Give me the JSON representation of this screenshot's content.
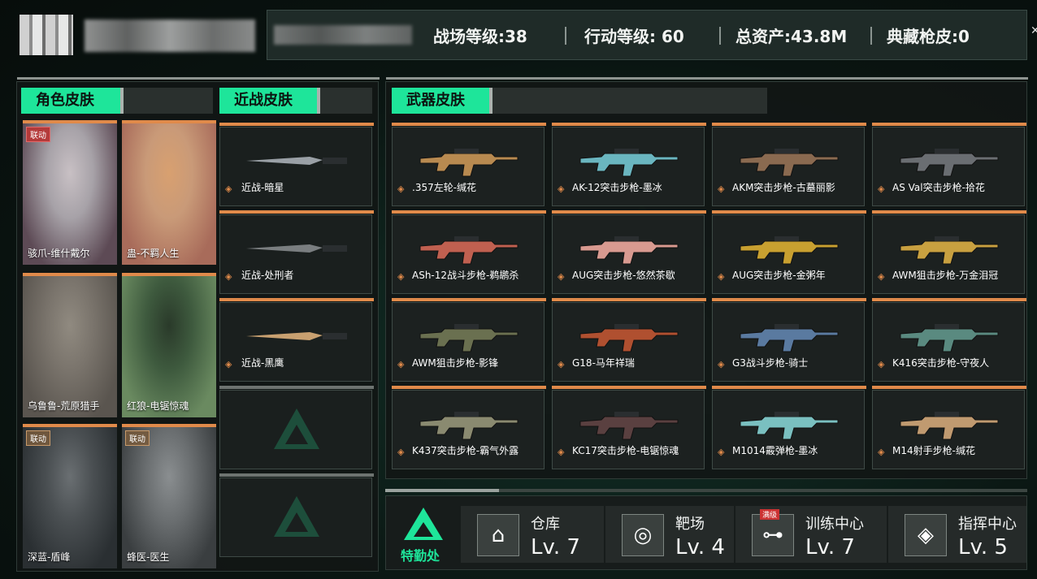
{
  "header": {
    "stats": [
      {
        "label": "战场等级:38"
      },
      {
        "label": "行动等级: 60"
      },
      {
        "label": "总资产:43.8M"
      },
      {
        "label": "典藏枪皮:0"
      }
    ]
  },
  "character_skins": {
    "tab": "角色皮肤",
    "items": [
      {
        "name": "骇爪-维什戴尔",
        "badge": "联动",
        "badge_style": "red",
        "art": [
          "#a7a2a8",
          "#5d4a55",
          "#c8c0c4"
        ]
      },
      {
        "name": "蛊-不羁人生",
        "badge": "",
        "badge_style": "",
        "art": [
          "#c99a78",
          "#a86b5a",
          "#d8a070"
        ]
      },
      {
        "name": "乌鲁鲁-荒原猎手",
        "badge": "",
        "badge_style": "",
        "art": [
          "#7a746c",
          "#5a554f",
          "#908a80"
        ]
      },
      {
        "name": "红狼-电锯惊魂",
        "badge": "",
        "badge_style": "",
        "art": [
          "#3e5a3e",
          "#6a8a60",
          "#2a3a2a"
        ]
      },
      {
        "name": "深蓝-盾峰",
        "badge": "联动",
        "badge_style": "tan",
        "art": [
          "#4a4f52",
          "#2a2f32",
          "#6a6f72"
        ]
      },
      {
        "name": "蜂医-医生",
        "badge": "联动",
        "badge_style": "tan",
        "art": [
          "#6a6e70",
          "#3a3e40",
          "#8a8e90"
        ]
      }
    ]
  },
  "melee_skins": {
    "tab": "近战皮肤",
    "items": [
      {
        "name": "近战-暗星",
        "color": "#9aa0a6"
      },
      {
        "name": "近战-处刑者",
        "color": "#7a7e80"
      },
      {
        "name": "近战-黑鹰",
        "color": "#c8a070"
      }
    ]
  },
  "weapon_skins": {
    "tab": "武器皮肤",
    "items": [
      {
        "name": ".357左轮-缄花",
        "color": "#b88a50"
      },
      {
        "name": "AK-12突击步枪-墨冰",
        "color": "#6ab6c0"
      },
      {
        "name": "AKM突击步枪-古墓丽影",
        "color": "#8a6a50"
      },
      {
        "name": "AS Val突击步枪-拾花",
        "color": "#6a6e72"
      },
      {
        "name": "ASh-12战斗步枪-鹈鹕杀",
        "color": "#c06050"
      },
      {
        "name": "AUG突击步枪-悠然茶歇",
        "color": "#d89a90"
      },
      {
        "name": "AUG突击步枪-金粥年",
        "color": "#c8a030"
      },
      {
        "name": "AWM狙击步枪-万金泪冠",
        "color": "#c8a040"
      },
      {
        "name": "AWM狙击步枪-影锋",
        "color": "#6a7050"
      },
      {
        "name": "G18-马年祥瑞",
        "color": "#b05030"
      },
      {
        "name": "G3战斗步枪-骑士",
        "color": "#5a7aa0"
      },
      {
        "name": "K416突击步枪-守夜人",
        "color": "#5a8a80"
      },
      {
        "name": "K437突击步枪-霸气外露",
        "color": "#8a8a70"
      },
      {
        "name": "KC17突击步枪-电锯惊魂",
        "color": "#5a4040"
      },
      {
        "name": "M1014霰弹枪-墨冰",
        "color": "#7ac0c0"
      },
      {
        "name": "M14射手步枪-缄花",
        "color": "#c09a70"
      }
    ]
  },
  "base": {
    "title": "特勤处",
    "facilities": [
      {
        "name": "仓库",
        "level": "Lv. 7",
        "icon": "warehouse-icon",
        "glyph": "⌂",
        "badge": ""
      },
      {
        "name": "靶场",
        "level": "Lv. 4",
        "icon": "target-icon",
        "glyph": "◎",
        "badge": ""
      },
      {
        "name": "训练中心",
        "level": "Lv. 7",
        "icon": "dumbbell-icon",
        "glyph": "⊶",
        "badge": "满级"
      },
      {
        "name": "指挥中心",
        "level": "Lv. 5",
        "icon": "command-icon",
        "glyph": "◈",
        "badge": ""
      }
    ]
  },
  "colors": {
    "accent": "#1ee59a",
    "rarity": "#e08a4a"
  }
}
